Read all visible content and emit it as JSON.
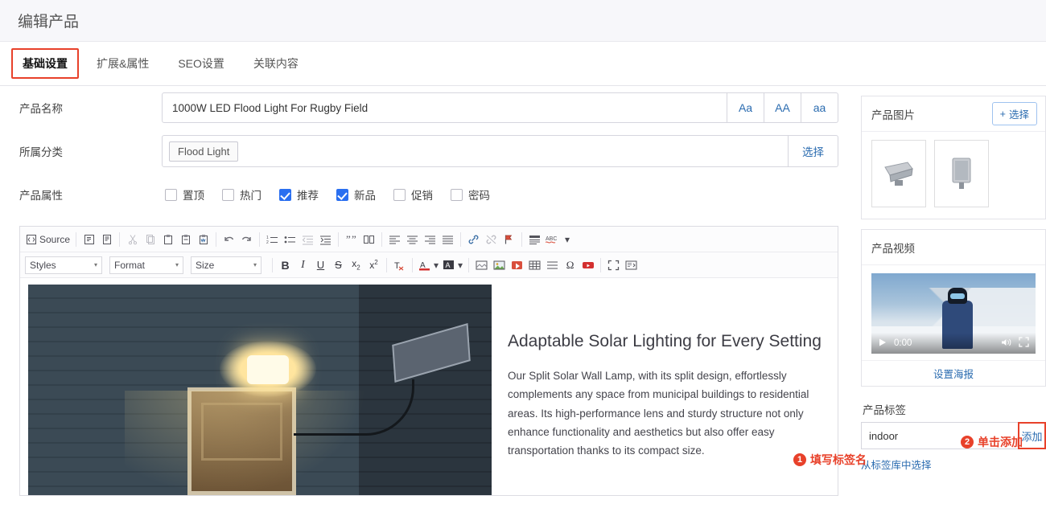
{
  "header": {
    "title": "编辑产品"
  },
  "tabs": [
    {
      "label": "基础设置",
      "active": true
    },
    {
      "label": "扩展&属性",
      "active": false
    },
    {
      "label": "SEO设置",
      "active": false
    },
    {
      "label": "关联内容",
      "active": false
    }
  ],
  "form": {
    "name_label": "产品名称",
    "name_value": "1000W LED Flood Light For Rugby Field",
    "name_placeholder": "",
    "case_buttons": [
      "Aa",
      "AA",
      "aa"
    ],
    "category_label": "所属分类",
    "category_chip": "Flood Light",
    "category_pick": "选择",
    "attrs_label": "产品属性",
    "attrs": [
      {
        "label": "置顶",
        "checked": false
      },
      {
        "label": "热门",
        "checked": false
      },
      {
        "label": "推荐",
        "checked": true
      },
      {
        "label": "新品",
        "checked": true
      },
      {
        "label": "促销",
        "checked": false
      },
      {
        "label": "密码",
        "checked": false
      }
    ]
  },
  "editor": {
    "toolbar_row1": [
      "source-button",
      "preview-icon",
      "templates-icon",
      "cut-icon",
      "copy-icon",
      "paste-icon",
      "paste-text-icon",
      "paste-word-icon",
      "undo-icon",
      "redo-icon",
      "numbered-list-icon",
      "bulleted-list-icon",
      "outdent-icon",
      "indent-icon",
      "blockquote-icon",
      "div-container-icon",
      "align-left-icon",
      "align-center-icon",
      "align-right-icon",
      "justify-icon",
      "link-icon",
      "unlink-icon",
      "anchor-icon",
      "show-blocks-icon",
      "spellcheck-icon"
    ],
    "source_label": "Source",
    "selects": [
      {
        "name": "styles",
        "value": "Styles"
      },
      {
        "name": "format",
        "value": "Format"
      },
      {
        "name": "size",
        "value": "Size"
      }
    ],
    "toolbar_row2": [
      "bold-icon",
      "italic-icon",
      "underline-icon",
      "strikethrough-icon",
      "subscript-icon",
      "superscript-icon",
      "remove-format-icon",
      "text-color-icon",
      "background-color-icon",
      "image-placeholder-icon",
      "image-icon",
      "flash-icon",
      "table-icon",
      "horizontal-rule-icon",
      "special-char-icon",
      "youtube-icon",
      "maximize-icon",
      "iframe-icon"
    ],
    "content": {
      "heading": "Adaptable Solar Lighting for Every Setting",
      "paragraph": "Our Split Solar Wall Lamp, with its split design, effortlessly complements any space from municipal buildings to residential areas. Its high-performance lens and sturdy structure not only enhance functionality and aesthetics but also offer easy transportation thanks to its compact size."
    }
  },
  "right": {
    "images_card": {
      "title": "产品图片",
      "select_label": "选择",
      "plus": "+"
    },
    "video_card": {
      "title": "产品视频",
      "time": "0:00",
      "poster_label": "设置海报"
    },
    "tags": {
      "label": "产品标签",
      "input_value": "indoor",
      "input_placeholder": "",
      "add_label": "添加",
      "library_link": "从标签库中选择"
    }
  },
  "annotations": [
    {
      "num": "1",
      "text": "填写标签名"
    },
    {
      "num": "2",
      "text": "单击添加"
    }
  ],
  "colors": {
    "accent_red": "#e8412a",
    "link_blue": "#2b6cb0",
    "checkbox_blue": "#2a6ff0"
  }
}
